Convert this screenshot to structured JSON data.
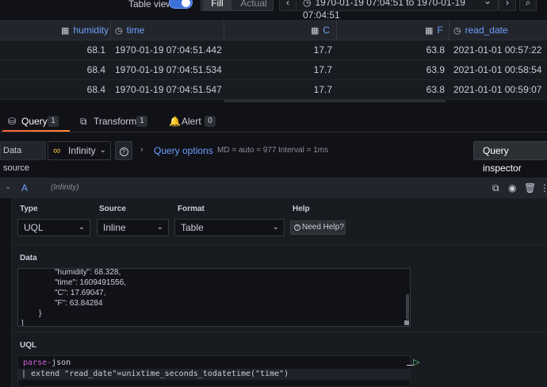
{
  "toolbar": {
    "table_view_label": "Table view",
    "fill_label": "Fill",
    "actual_label": "Actual",
    "prev_icon": "‹",
    "time_range": "1970-01-19 07:04:51 to 1970-01-19 07:04:51",
    "range_chevron": "⌄",
    "next_icon": "›",
    "zoom_icon": "⌕"
  },
  "table": {
    "columns": [
      {
        "label": "humidity"
      },
      {
        "label": "time"
      },
      {
        "label": "C"
      },
      {
        "label": "F"
      },
      {
        "label": "read_date"
      }
    ],
    "rows": [
      {
        "humidity": "68.1",
        "time": "1970-01-19 07:04:51.442",
        "C": "17.7",
        "F": "63.8",
        "read_date": "2021-01-01 00:57:22"
      },
      {
        "humidity": "68.4",
        "time": "1970-01-19 07:04:51.534",
        "C": "17.7",
        "F": "63.9",
        "read_date": "2021-01-01 00:58:54"
      },
      {
        "humidity": "68.4",
        "time": "1970-01-19 07:04:51.547",
        "C": "17.7",
        "F": "63.8",
        "read_date": "2021-01-01 00:59:07"
      }
    ]
  },
  "tabs": [
    {
      "label": "Query",
      "count": "1"
    },
    {
      "label": "Transform",
      "count": "1"
    },
    {
      "label": "Alert",
      "count": "0"
    }
  ],
  "datasource": {
    "label": "Data source",
    "name": "Infinity",
    "query_options_label": "Query options",
    "md_info": "MD = auto = 977",
    "interval_info": "Interval = 1ms",
    "inspector_label": "Query inspector"
  },
  "query": {
    "ref_id": "A",
    "datasource_name": "(Infinity)",
    "type_label": "Type",
    "type_value": "UQL",
    "source_label": "Source",
    "source_value": "Inline",
    "format_label": "Format",
    "format_value": "Table",
    "help_label": "Help",
    "need_help_label": "Need Help?",
    "data_label": "Data",
    "data_lines": [
      "\"humidity\": 68.328,",
      "\"time\": 1609491556,",
      "\"C\": 17.69047,",
      "\"F\": 63.84284",
      "}",
      "]"
    ],
    "uql_label": "UQL",
    "uql_keyword": "parse-",
    "uql_line1_rest": "json",
    "uql_line2": "| extend \"read_date\"=unixtime_seconds_todatetime(\"time\")"
  },
  "colors": {
    "accent": "#6e9fff",
    "tab_underline": "#f55f3e",
    "run_green": "#6ccf8e",
    "keyword": "#ce5fd8"
  }
}
